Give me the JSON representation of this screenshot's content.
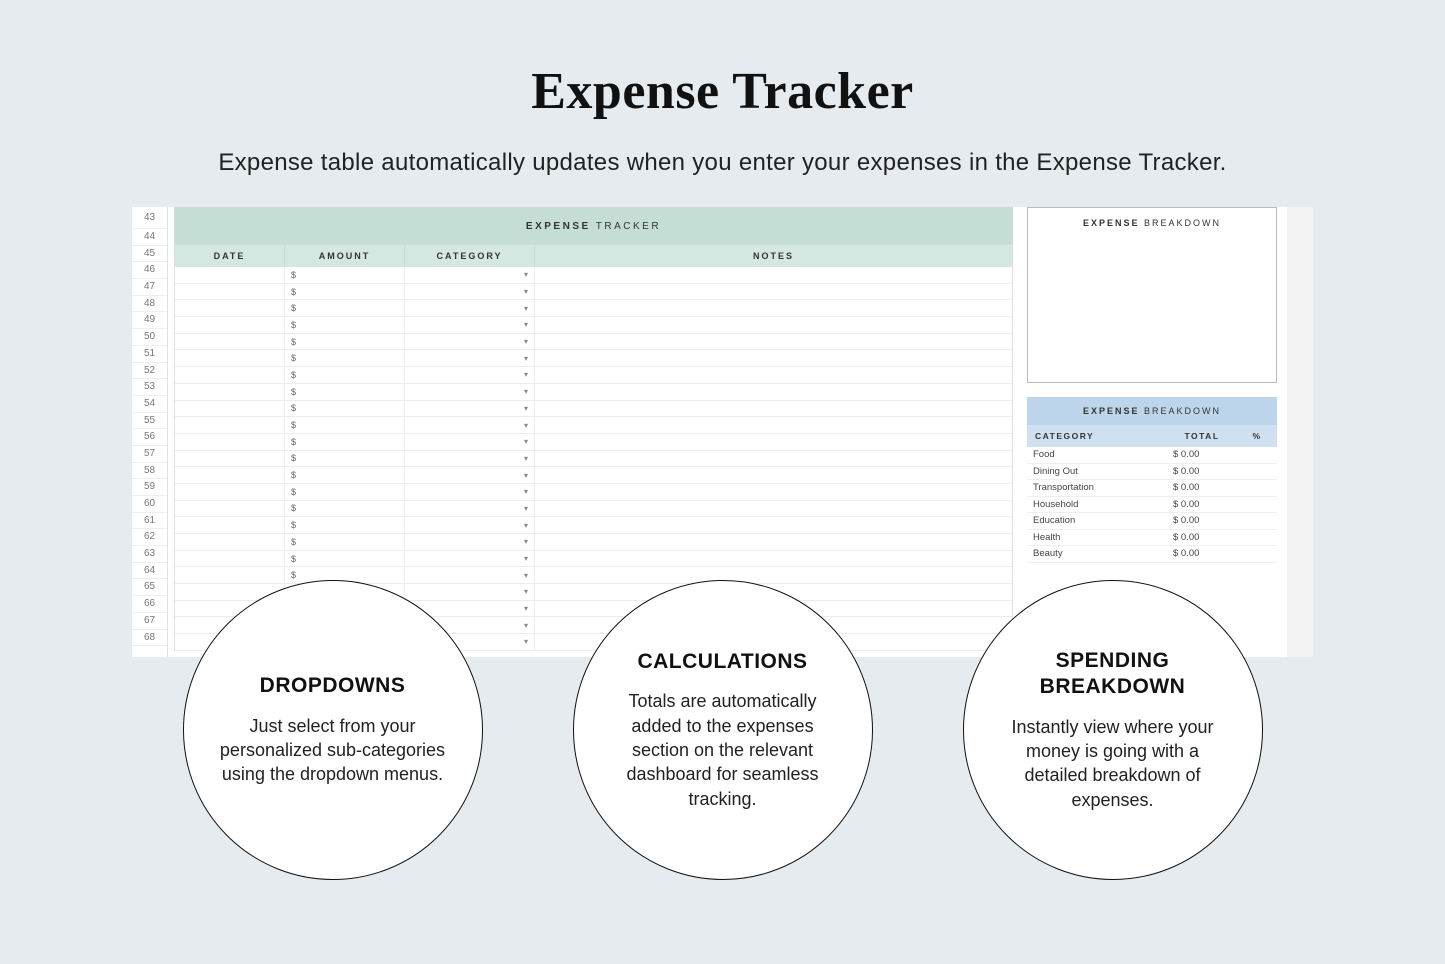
{
  "title": "Expense Tracker",
  "subtitle": "Expense table automatically updates when you enter your expenses in the Expense Tracker.",
  "sheet": {
    "row_start": 43,
    "row_end": 68,
    "tracker_title_bold": "EXPENSE",
    "tracker_title_rest": "TRACKER",
    "columns": {
      "date": "DATE",
      "amount": "AMOUNT",
      "category": "CATEGORY",
      "notes": "NOTES"
    },
    "amount_prefix": "$",
    "row_count": 23
  },
  "chart_panel": {
    "title_bold": "EXPENSE",
    "title_rest": "BREAKDOWN"
  },
  "breakdown": {
    "title_bold": "EXPENSE",
    "title_rest": "BREAKDOWN",
    "columns": {
      "category": "CATEGORY",
      "total": "TOTAL",
      "pct": "%"
    },
    "rows": [
      {
        "category": "Food",
        "total": "$  0.00",
        "pct": ""
      },
      {
        "category": "Dining Out",
        "total": "$  0.00",
        "pct": ""
      },
      {
        "category": "Transportation",
        "total": "$  0.00",
        "pct": ""
      },
      {
        "category": "Household",
        "total": "$  0.00",
        "pct": ""
      },
      {
        "category": "Education",
        "total": "$  0.00",
        "pct": ""
      },
      {
        "category": "Health",
        "total": "$  0.00",
        "pct": ""
      },
      {
        "category": "Beauty",
        "total": "$  0.00",
        "pct": ""
      }
    ]
  },
  "callouts": [
    {
      "title": "DROPDOWNS",
      "body": "Just select from your personalized sub-categories using the dropdown menus."
    },
    {
      "title": "CALCULATIONS",
      "body": "Totals are automatically added to the expenses section on the relevant dashboard for seamless tracking."
    },
    {
      "title": "SPENDING BREAKDOWN",
      "body": "Instantly view where your money is going with a detailed breakdown of expenses."
    }
  ]
}
